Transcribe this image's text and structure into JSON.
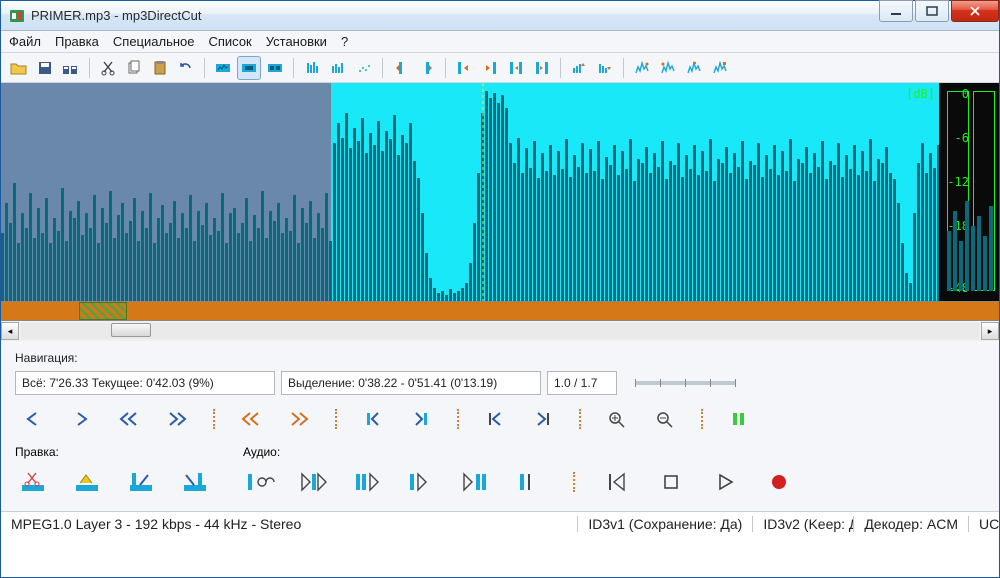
{
  "window": {
    "title": "PRIMER.mp3 - mp3DirectCut"
  },
  "menu": {
    "items": [
      "Файл",
      "Правка",
      "Специальное",
      "Список",
      "Установки",
      "?"
    ]
  },
  "db_scale": {
    "unit": "[dB]",
    "marks": [
      "0",
      "-6",
      "-12",
      "-18",
      "-48"
    ]
  },
  "navigation": {
    "label": "Навигация:",
    "total": "Всё: 7'26.33   Текущее: 0'42.03   (9%)",
    "selection": "Выделение: 0'38.22 - 0'51.41 (0'13.19)",
    "zoom": "1.0 / 1.7"
  },
  "edit": {
    "label": "Правка:"
  },
  "audio": {
    "label": "Аудио:"
  },
  "status": {
    "format": "MPEG1.0 Layer 3 - 192 kbps - 44 kHz - Stereo",
    "id3v1": "ID3v1 (Сохранение: Да)",
    "id3v2": "ID3v2 (Keep: Д",
    "decoder": "Декодер: ACM",
    "extra": "UC"
  },
  "toolbar_icons": [
    "open",
    "save",
    "save-split",
    "",
    "cut",
    "copy",
    "paste",
    "undo",
    "",
    "view-a",
    "view-b",
    "view-c",
    "",
    "region-a",
    "region-b",
    "region-c",
    "",
    "mark-in",
    "mark-out",
    "",
    "sel-left",
    "sel-right",
    "sel-shrink",
    "sel-grow",
    "",
    "edit-a",
    "edit-b",
    "",
    "fx-a",
    "fx-b",
    "fx-c",
    "fx-d"
  ]
}
